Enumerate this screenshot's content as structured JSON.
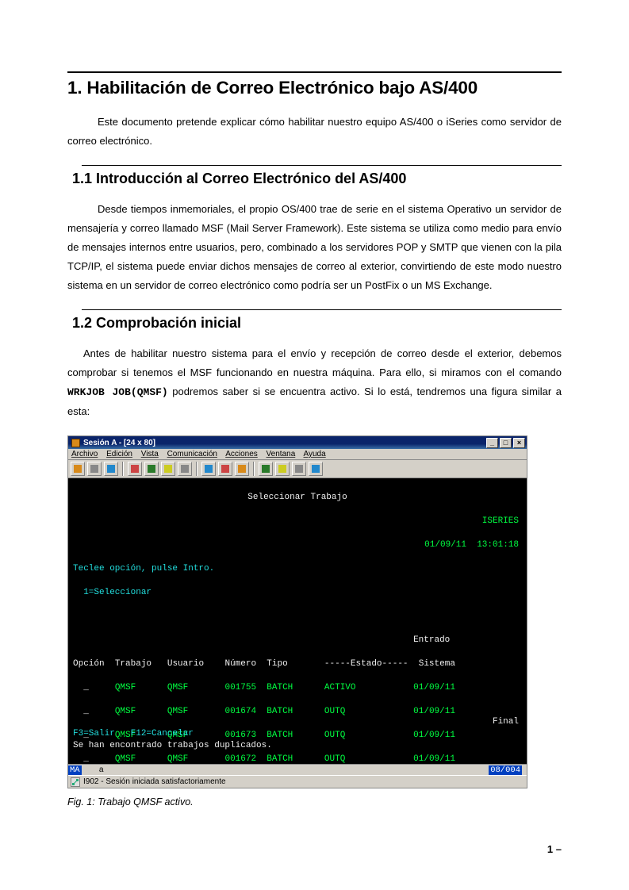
{
  "doc": {
    "h1": "1. Habilitación de Correo Electrónico bajo AS/400",
    "intro": "Este documento pretende explicar cómo habilitar nuestro equipo AS/400 o iSeries como servidor de correo electrónico.",
    "s1": {
      "title": "1.1 Introducción al Correo Electrónico del AS/400",
      "body": "Desde tiempos inmemoriales, el propio OS/400 trae de serie en el sistema Operativo un servidor de mensajería y correo llamado MSF (Mail Server Framework). Este sistema se utiliza como medio para envío de mensajes internos entre usuarios, pero, combinado a los servidores POP y SMTP que vienen con la pila TCP/IP, el sistema puede enviar dichos mensajes de correo al exterior, convirtiendo de este modo nuestro sistema en un servidor de correo electrónico como podría ser un PostFix o un MS Exchange."
    },
    "s2": {
      "title": "1.2 Comprobación inicial",
      "body_pre": "Antes de habilitar nuestro sistema para el envío y recepción de correo desde el exterior, debemos comprobar si tenemos el MSF funcionando en nuestra máquina. Para ello, si miramos con el comando ",
      "cmd": "WRKJOB JOB(QMSF)",
      "body_post": " podremos saber si se encuentra activo. Si lo está, tendremos una figura similar a esta:"
    },
    "fig_caption": "Fig. 1: Trabajo QMSF activo.",
    "page_num": "1 –"
  },
  "term": {
    "window_title": "Sesión A - [24 x 80]",
    "menus": [
      "Archivo",
      "Edición",
      "Vista",
      "Comunicación",
      "Acciones",
      "Ventana",
      "Ayuda"
    ],
    "screen_title": "Seleccionar Trabajo",
    "system": "ISERIES",
    "date": "01/09/11",
    "time": "13:01:18",
    "prompt": "Teclee opción, pulse Intro.",
    "option_hint": "1=Seleccionar",
    "cols": {
      "option": "Opción",
      "job": "Trabajo",
      "user": "Usuario",
      "number": "Número",
      "type": "Tipo",
      "state": "-----Estado-----",
      "entered_top": "Entrado",
      "entered_bot": "Sistema"
    },
    "rows": [
      {
        "job": "QMSF",
        "user": "QMSF",
        "num": "001755",
        "type": "BATCH",
        "state": "ACTIVO",
        "date": "01/09/11"
      },
      {
        "job": "QMSF",
        "user": "QMSF",
        "num": "001674",
        "type": "BATCH",
        "state": "OUTQ",
        "date": "01/09/11"
      },
      {
        "job": "QMSF",
        "user": "QMSF",
        "num": "001673",
        "type": "BATCH",
        "state": "OUTQ",
        "date": "01/09/11"
      },
      {
        "job": "QMSF",
        "user": "QMSF",
        "num": "001672",
        "type": "BATCH",
        "state": "OUTQ",
        "date": "01/09/11"
      }
    ],
    "final": "Final",
    "fkeys": "F3=Salir   F12=Cancelar",
    "msg": "Se han encontrado trabajos duplicados.",
    "oia": {
      "left": "MA",
      "mid": "a",
      "right": "08/004"
    },
    "statusbar": "I902 - Sesión iniciada satisfactoriamente"
  }
}
